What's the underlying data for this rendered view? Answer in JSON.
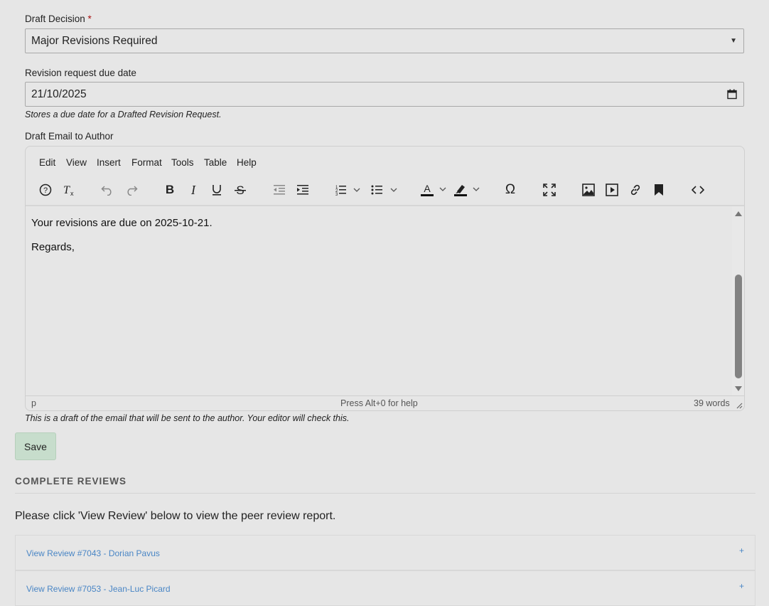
{
  "decision": {
    "label": "Draft Decision",
    "required_mark": "*",
    "selected": "Major Revisions Required"
  },
  "due_date": {
    "label": "Revision request due date",
    "value": "21/10/2025",
    "help": "Stores a due date for a Drafted Revision Request."
  },
  "email": {
    "label": "Draft Email to Author",
    "menu": [
      "Edit",
      "View",
      "Insert",
      "Format",
      "Tools",
      "Table",
      "Help"
    ],
    "toolbar_icons": [
      "help-icon",
      "clear-format-icon",
      "undo-icon",
      "redo-icon",
      "bold-icon",
      "italic-icon",
      "underline-icon",
      "strikethrough-icon",
      "outdent-icon",
      "indent-icon",
      "numbered-list-icon",
      "bullet-list-icon",
      "text-color-icon",
      "highlight-icon",
      "special-char-icon",
      "fullscreen-icon",
      "image-icon",
      "media-icon",
      "link-icon",
      "bookmark-icon",
      "source-code-icon"
    ],
    "body_lines": [
      "Your revisions are due on 2025-10-21.",
      "Regards,"
    ],
    "status_path": "p",
    "status_help": "Press Alt+0 for help",
    "word_count": "39 words",
    "help": "This is a draft of the email that will be sent to the author. Your editor will check this."
  },
  "save_label": "Save",
  "reviews": {
    "heading": "COMPLETE REVIEWS",
    "intro": "Please click 'View Review' below to view the peer review report.",
    "items": [
      {
        "label": "View Review #7043 - Dorian Pavus",
        "toggle": "+"
      },
      {
        "label": "View Review #7053 - Jean-Luc Picard",
        "toggle": "+"
      }
    ]
  }
}
